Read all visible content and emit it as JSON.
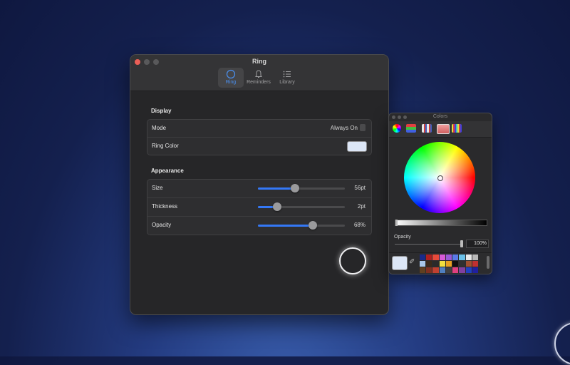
{
  "window": {
    "title": "Ring",
    "tabs": [
      {
        "label": "Ring",
        "icon": "circle-icon",
        "active": true
      },
      {
        "label": "Reminders",
        "icon": "bell-icon",
        "active": false
      },
      {
        "label": "Library",
        "icon": "list-icon",
        "active": false
      }
    ]
  },
  "display": {
    "section_title": "Display",
    "mode_label": "Mode",
    "mode_value": "Always On",
    "ring_color_label": "Ring Color",
    "ring_color": "#dce6f6"
  },
  "appearance": {
    "section_title": "Appearance",
    "sliders": [
      {
        "label": "Size",
        "value_text": "56pt",
        "fraction": 0.43
      },
      {
        "label": "Thickness",
        "value_text": "2pt",
        "fraction": 0.22
      },
      {
        "label": "Opacity",
        "value_text": "68%",
        "fraction": 0.63
      }
    ]
  },
  "colors_panel": {
    "title": "Colors",
    "opacity_label": "Opacity",
    "opacity_value": "100%",
    "selected_color": "#dce6f6",
    "modes": [
      "color-wheel-icon",
      "color-sliders-icon",
      "color-palettes-icon",
      "image-palettes-icon",
      "pencils-icon"
    ],
    "swatches": [
      "#1a2a8a",
      "#b02020",
      "#e84a3a",
      "#d85ad8",
      "#9a5ad8",
      "#5a7ae8",
      "#6ac0e8",
      "#e8e8e8",
      "#b8b8b8",
      "#a8c8e8",
      "#3a2a1a",
      "#2a2a2a",
      "#f0e040",
      "#e8a020",
      "#101010",
      "#303030",
      "#a05030",
      "#c03030",
      "#604020",
      "#803020",
      "#c04030",
      "#5080c0",
      "#404040",
      "#e04080",
      "#8040a0",
      "#2040c0",
      "#2020a0"
    ]
  }
}
